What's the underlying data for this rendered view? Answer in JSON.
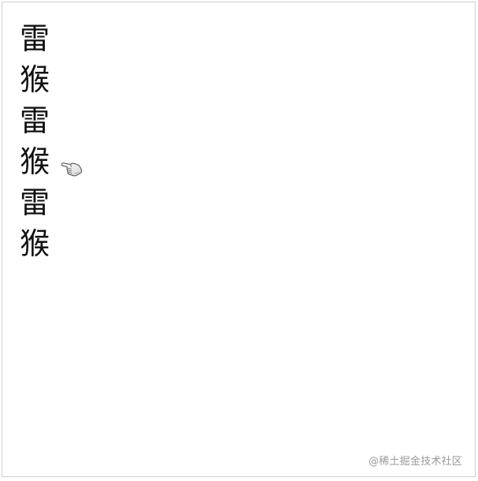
{
  "characters": [
    {
      "text": "雷"
    },
    {
      "text": "猴"
    },
    {
      "text": "雷"
    },
    {
      "text": "猴"
    },
    {
      "text": "雷"
    },
    {
      "text": "猴"
    }
  ],
  "cursor": {
    "icon": "pointing-hand-icon",
    "hover_item_index": 3
  },
  "watermark": {
    "text": "@稀土掘金技术社区"
  },
  "colors": {
    "text": "#111111",
    "border": "#cfcfcf",
    "watermark": "#9a9a9a",
    "background": "#ffffff"
  }
}
